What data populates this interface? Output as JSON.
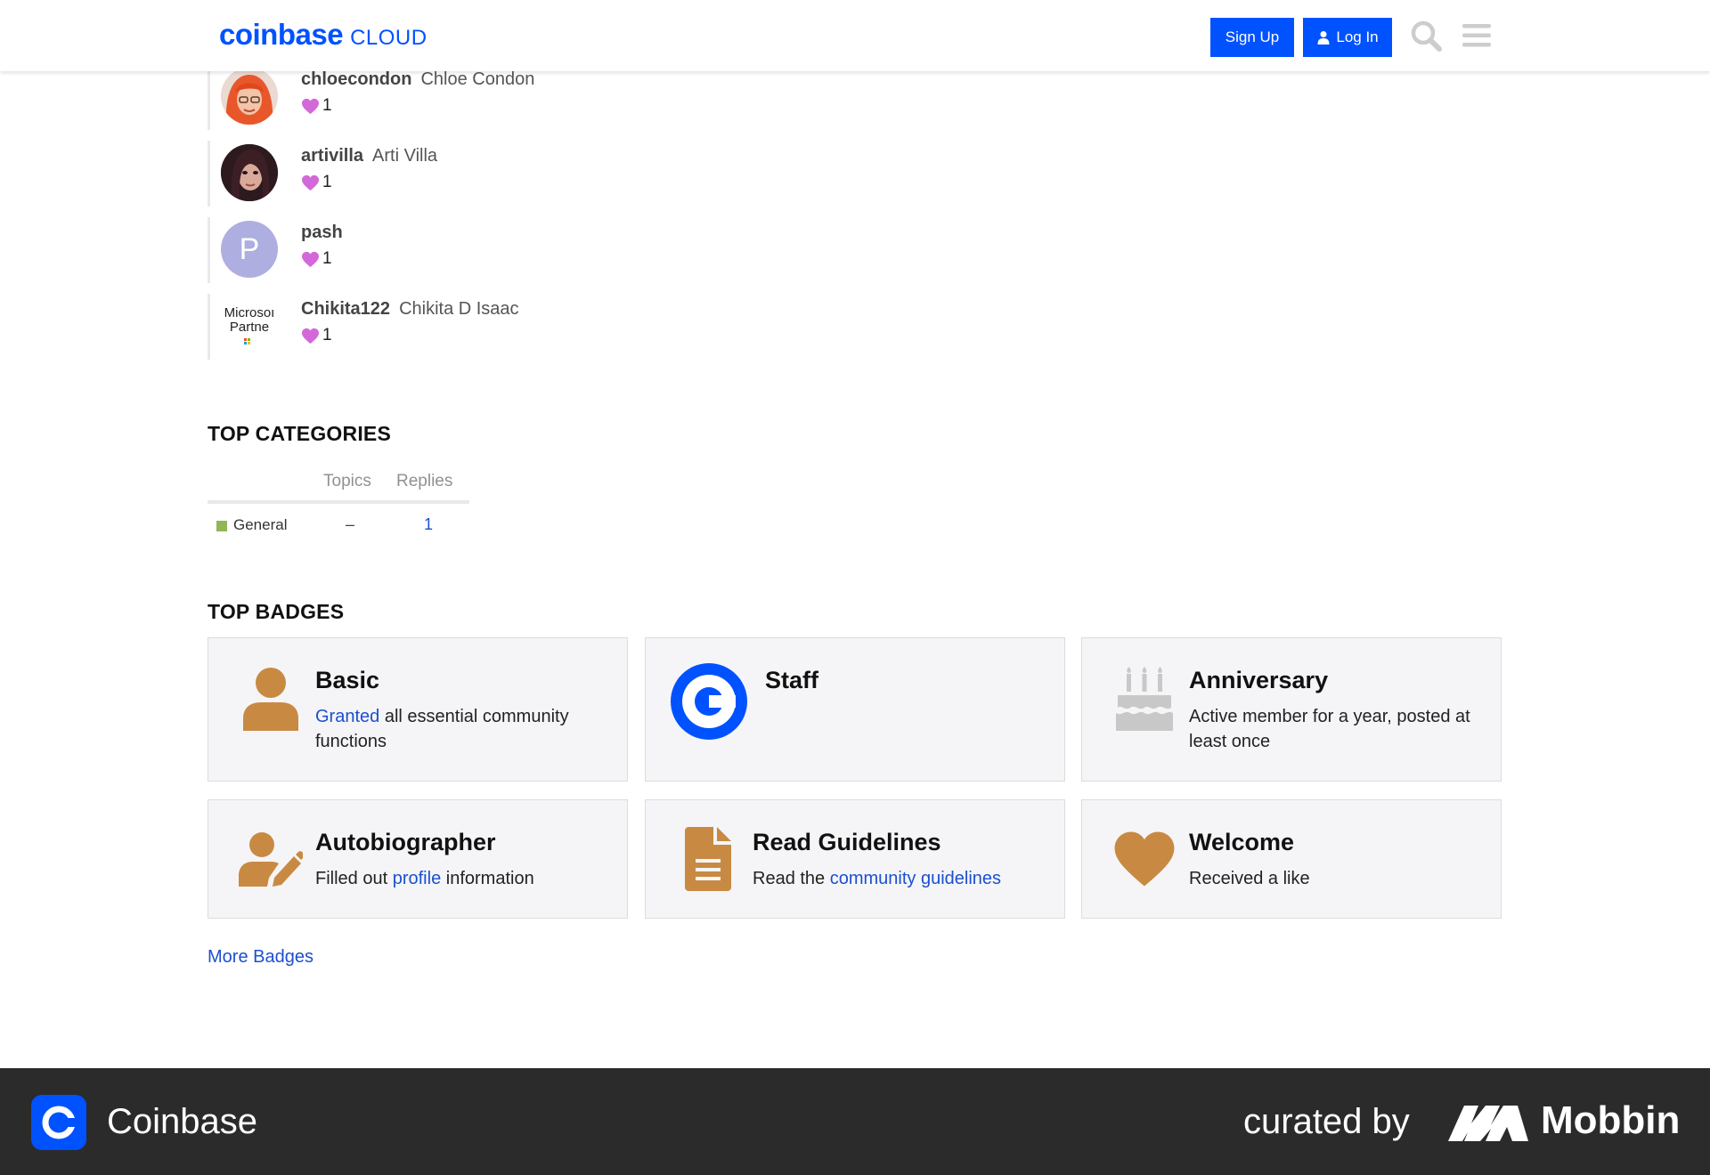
{
  "header": {
    "logo_main": "coinbase",
    "logo_sub": "CLOUD",
    "signup_label": "Sign Up",
    "login_label": "Log In"
  },
  "likers": [
    {
      "username": "chloecondon",
      "fullname": "Chloe Condon",
      "likes": "1"
    },
    {
      "username": "artivilla",
      "fullname": "Arti Villa",
      "likes": "1"
    },
    {
      "username": "pash",
      "fullname": "",
      "likes": "1",
      "avatar_letter": "P"
    },
    {
      "username": "Chikita122",
      "fullname": "Chikita D Isaac",
      "likes": "1",
      "avatar_text_1": "Microsoı",
      "avatar_text_2": "Partne"
    }
  ],
  "top_categories": {
    "title": "TOP CATEGORIES",
    "columns": [
      "Topics",
      "Replies"
    ],
    "rows": [
      {
        "name": "General",
        "topics": "–",
        "replies": "1",
        "color": "#92b557"
      }
    ]
  },
  "top_badges": {
    "title": "TOP BADGES",
    "items": [
      {
        "name": "Basic",
        "desc_link": "Granted",
        "desc_rest": " all essential community functions",
        "icon": "user-icon"
      },
      {
        "name": "Staff",
        "icon": "coinbase-icon"
      },
      {
        "name": "Anniversary",
        "desc_rest": "Active member for a year, posted at least once",
        "icon": "birthday-cake-icon"
      },
      {
        "name": "Autobiographer",
        "desc_pre": "Filled out ",
        "desc_link": "profile",
        "desc_rest": " information",
        "icon": "user-edit-icon"
      },
      {
        "name": "Read Guidelines",
        "desc_pre": "Read the ",
        "desc_link": "community guidelines",
        "icon": "file-icon"
      },
      {
        "name": "Welcome",
        "desc_rest": "Received a like",
        "icon": "heart-icon"
      }
    ],
    "more_label": "More Badges"
  },
  "footer": {
    "app_name": "Coinbase",
    "curated_by": "curated by",
    "brand": "Mobbin"
  },
  "colors": {
    "brand_blue": "#0052ff",
    "link_blue": "#1c4fd0",
    "badge_bronze": "#c88a42",
    "like_pink": "#d368d9"
  }
}
